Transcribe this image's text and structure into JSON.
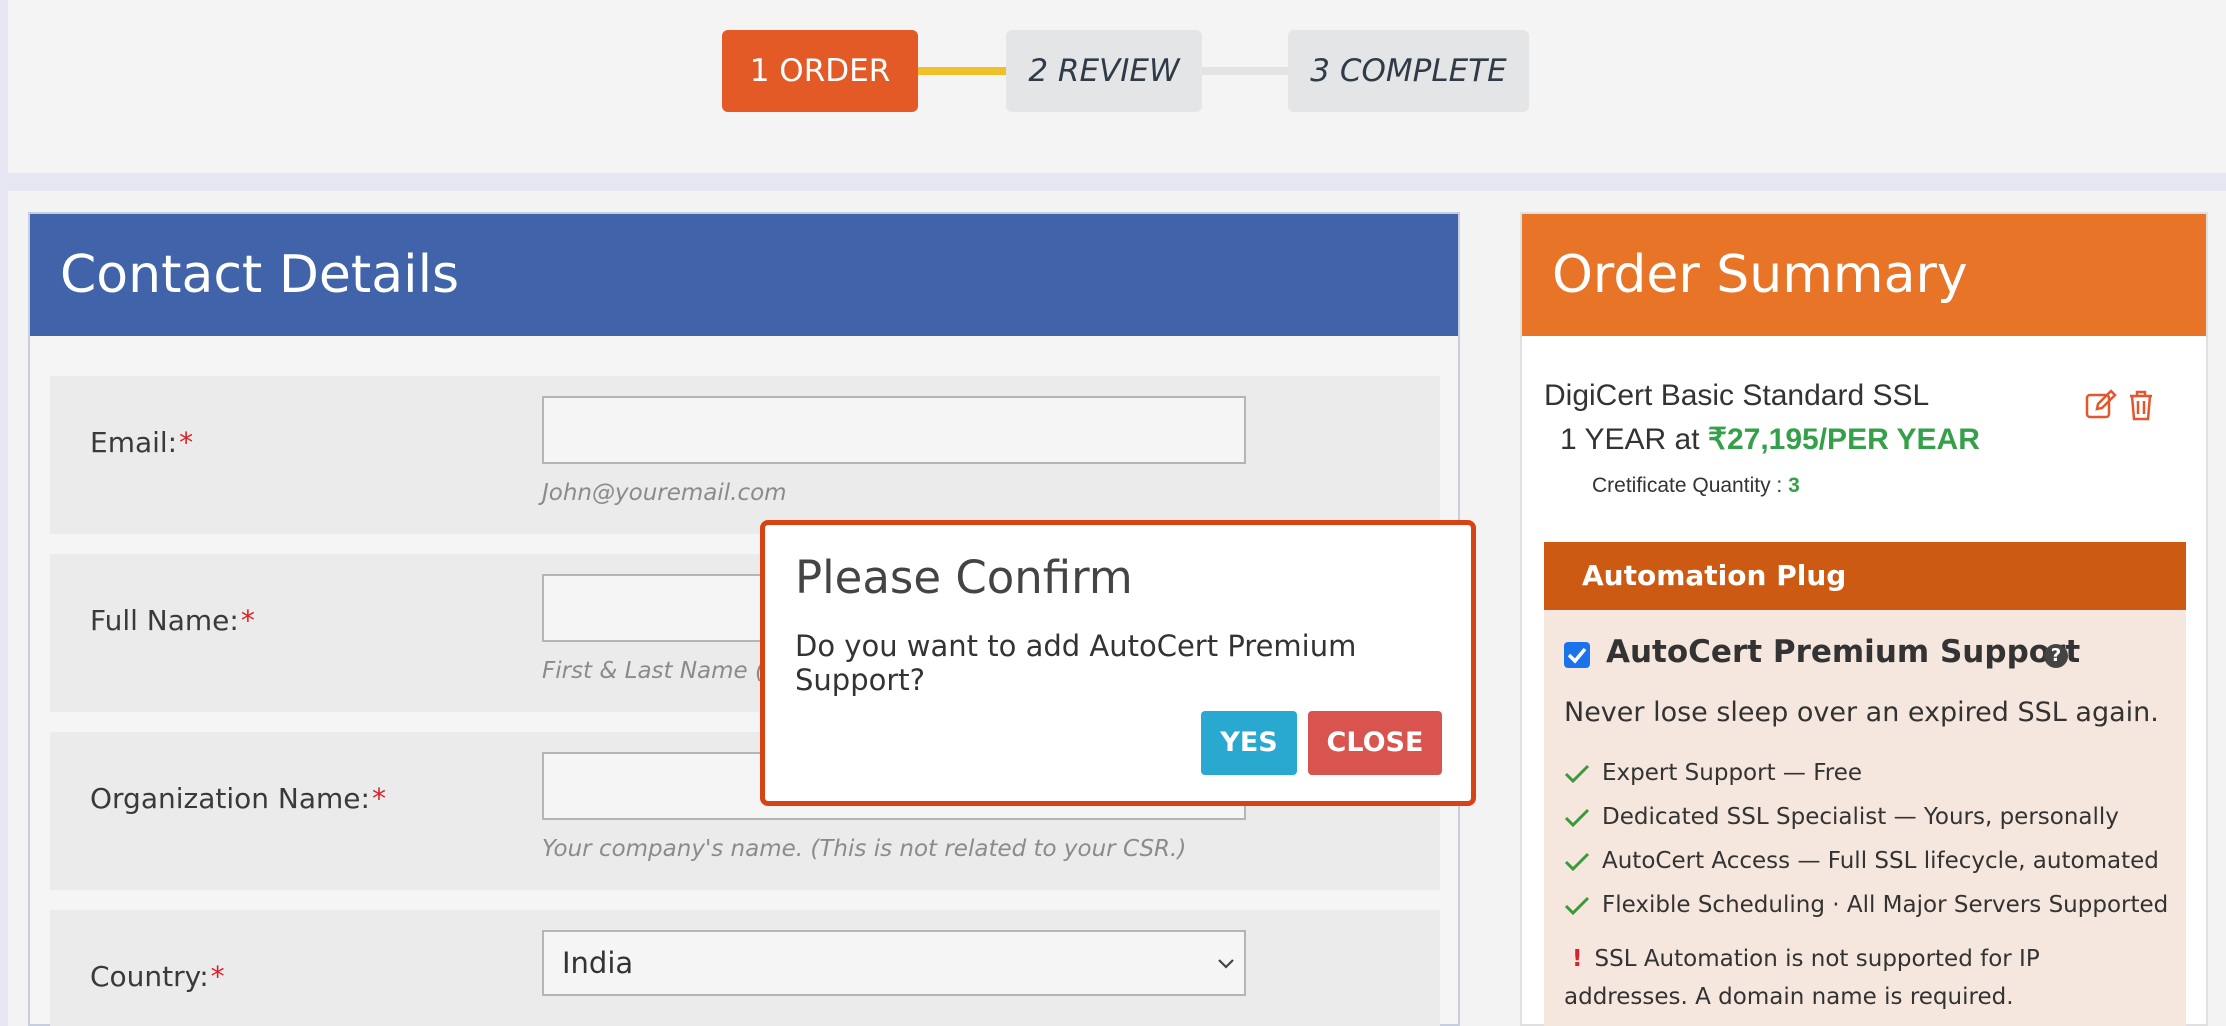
{
  "steps": {
    "order": "1 ORDER",
    "review": "2 REVIEW",
    "complete": "3 COMPLETE"
  },
  "contact": {
    "title": "Contact Details",
    "email": {
      "label": "Email:",
      "required": "*",
      "value": "",
      "help": "John@youremail.com"
    },
    "full_name": {
      "label": "Full Name:",
      "required": "*",
      "value": "",
      "help": "First & Last Name (i.e."
    },
    "organization": {
      "label": "Organization Name:",
      "required": "*",
      "value": "",
      "help": "Your company's name. (This is not related to your CSR.)"
    },
    "country": {
      "label": "Country:",
      "required": "*",
      "selected": "India"
    }
  },
  "summary": {
    "title": "Order Summary",
    "product_name": "DigiCert Basic Standard SSL",
    "term": "1 YEAR at ",
    "price": "₹27,195/PER YEAR",
    "quantity_label": "Cretificate Quantity : ",
    "quantity": "3"
  },
  "plug": {
    "title": "Automation Plug",
    "checked": true,
    "product": "AutoCert Premium Support",
    "help_glyph": "?",
    "tagline": "Never lose sleep over an expired SSL again.",
    "features": [
      "Expert Support — Free",
      "Dedicated SSL Specialist — Yours, personally",
      "AutoCert Access — Full SSL lifecycle, automated",
      "Flexible Scheduling · All Major Servers Supported"
    ],
    "warning_glyph": "!",
    "warning": "SSL Automation is not supported for IP addresses. A domain name is required."
  },
  "modal": {
    "title": "Please Confirm",
    "message": "Do you want to add AutoCert Premium Support?",
    "yes_label": "YES",
    "close_label": "CLOSE"
  },
  "colors": {
    "active_step": "#e45a26",
    "contact_header": "#4163a9",
    "summary_header": "#e87428",
    "plug_header": "#cc5a12",
    "price_green": "#35a04a",
    "yes_button": "#29a8d0",
    "close_button": "#d9534f",
    "modal_border": "#d84315"
  },
  "icons": [
    "edit-icon",
    "trash-icon",
    "checkmark-icon",
    "help-icon",
    "chevron-down-icon"
  ]
}
